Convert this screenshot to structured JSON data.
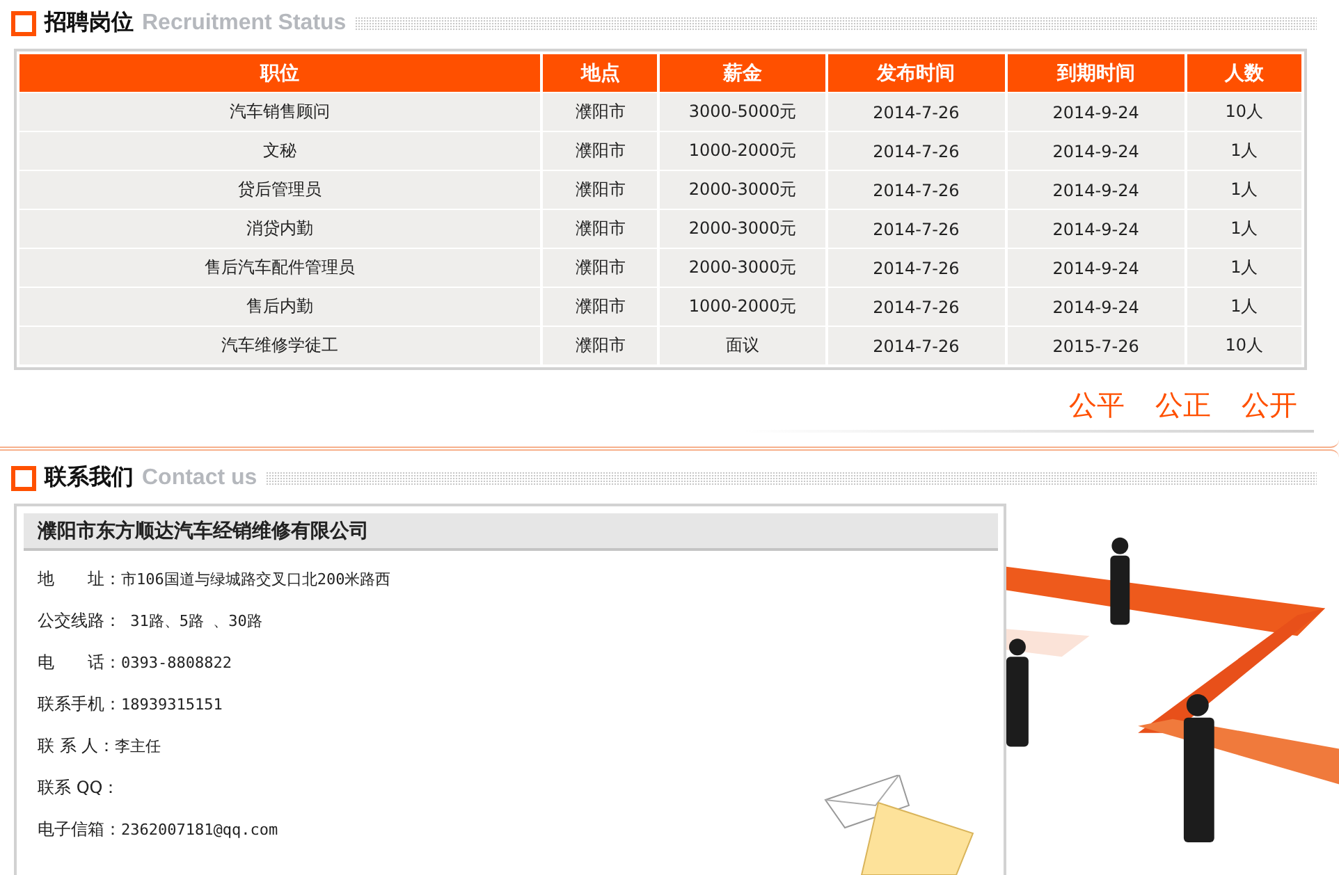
{
  "recruitment": {
    "title": "招聘岗位",
    "subtitle": "Recruitment Status",
    "columns": [
      "职位",
      "地点",
      "薪金",
      "发布时间",
      "到期时间",
      "人数"
    ],
    "rows": [
      [
        "汽车销售顾问",
        "濮阳市",
        "3000-5000元",
        "2014-7-26",
        "2014-9-24",
        "10人"
      ],
      [
        "文秘",
        "濮阳市",
        "1000-2000元",
        "2014-7-26",
        "2014-9-24",
        "1人"
      ],
      [
        "贷后管理员",
        "濮阳市",
        "2000-3000元",
        "2014-7-26",
        "2014-9-24",
        "1人"
      ],
      [
        "消贷内勤",
        "濮阳市",
        "2000-3000元",
        "2014-7-26",
        "2014-9-24",
        "1人"
      ],
      [
        "售后汽车配件管理员",
        "濮阳市",
        "2000-3000元",
        "2014-7-26",
        "2014-9-24",
        "1人"
      ],
      [
        "售后内勤",
        "濮阳市",
        "1000-2000元",
        "2014-7-26",
        "2014-9-24",
        "1人"
      ],
      [
        "汽车维修学徒工",
        "濮阳市",
        "面议",
        "2014-7-26",
        "2015-7-26",
        "10人"
      ]
    ],
    "slogan": [
      "公平",
      "公正",
      "公开"
    ]
  },
  "contact": {
    "title": "联系我们",
    "subtitle": "Contact us",
    "company": "濮阳市东方顺达汽车经销维修有限公司",
    "lines": [
      {
        "label": "地　　址：",
        "value": "市106国道与绿城路交叉口北200米路西"
      },
      {
        "label": "公交线路：",
        "value": " 31路、5路 、30路"
      },
      {
        "label": "电　　话：",
        "value": "0393-8808822"
      },
      {
        "label": "联系手机：",
        "value": "18939315151"
      },
      {
        "label": "联 系 人：",
        "value": "李主任"
      },
      {
        "label": "联系 QQ："
      },
      {
        "label": "电子信箱：",
        "value": "2362007181@qq.com"
      }
    ]
  }
}
